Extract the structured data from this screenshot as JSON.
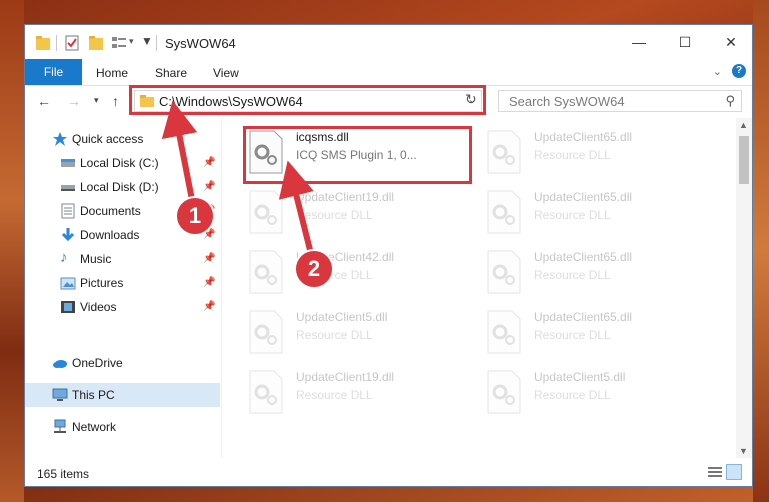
{
  "window": {
    "title": "SysWOW64",
    "min_glyph": "—",
    "max_glyph": "☐",
    "close_glyph": "✕"
  },
  "ribbon": {
    "tabs": [
      {
        "label": "File"
      },
      {
        "label": "Home"
      },
      {
        "label": "Share"
      },
      {
        "label": "View"
      }
    ],
    "help": "?"
  },
  "address": {
    "path": "C:\\Windows\\SysWOW64",
    "search_placeholder": "Search SysWOW64"
  },
  "sidebar": {
    "items": [
      {
        "label": "Quick access",
        "icon": "star-icon",
        "pinned": false
      },
      {
        "label": "Local Disk (C:)",
        "icon": "drive-icon",
        "pinned": true
      },
      {
        "label": "Local Disk (D:)",
        "icon": "drive-icon",
        "pinned": true
      },
      {
        "label": "Documents",
        "icon": "documents-icon",
        "pinned": true
      },
      {
        "label": "Downloads",
        "icon": "download-icon",
        "pinned": true
      },
      {
        "label": "Music",
        "icon": "music-icon",
        "pinned": true
      },
      {
        "label": "Pictures",
        "icon": "pictures-icon",
        "pinned": true
      },
      {
        "label": "Videos",
        "icon": "videos-icon",
        "pinned": true
      },
      {
        "label": "OneDrive",
        "icon": "cloud-icon",
        "pinned": false
      },
      {
        "label": "This PC",
        "icon": "computer-icon",
        "pinned": false,
        "selected": true
      },
      {
        "label": "Network",
        "icon": "network-icon",
        "pinned": false
      }
    ]
  },
  "files": [
    {
      "name": "icqsms.dll",
      "type": "ICQ SMS Plugin 1, 0...",
      "highlighted": true
    },
    {
      "name": "UpdateClient65.dll",
      "type": "Resource DLL"
    },
    {
      "name": "UpdateClient19.dll",
      "type": "Resource DLL"
    },
    {
      "name": "UpdateClient65.dll",
      "type": "Resource DLL"
    },
    {
      "name": "UpdateClient42.dll",
      "type": "Resource DLL"
    },
    {
      "name": "UpdateClient65.dll",
      "type": "Resource DLL"
    },
    {
      "name": "UpdateClient5.dll",
      "type": "Resource DLL"
    },
    {
      "name": "UpdateClient65.dll",
      "type": "Resource DLL"
    },
    {
      "name": "UpdateClient19.dll",
      "type": "Resource DLL"
    },
    {
      "name": "UpdateClient5.dll",
      "type": "Resource DLL"
    }
  ],
  "status": {
    "count": "165 items"
  },
  "annotations": {
    "badge1": "1",
    "badge2": "2"
  },
  "colors": {
    "accent": "#1979ca",
    "highlight": "#d9363e",
    "selection": "#d9e8f7"
  }
}
